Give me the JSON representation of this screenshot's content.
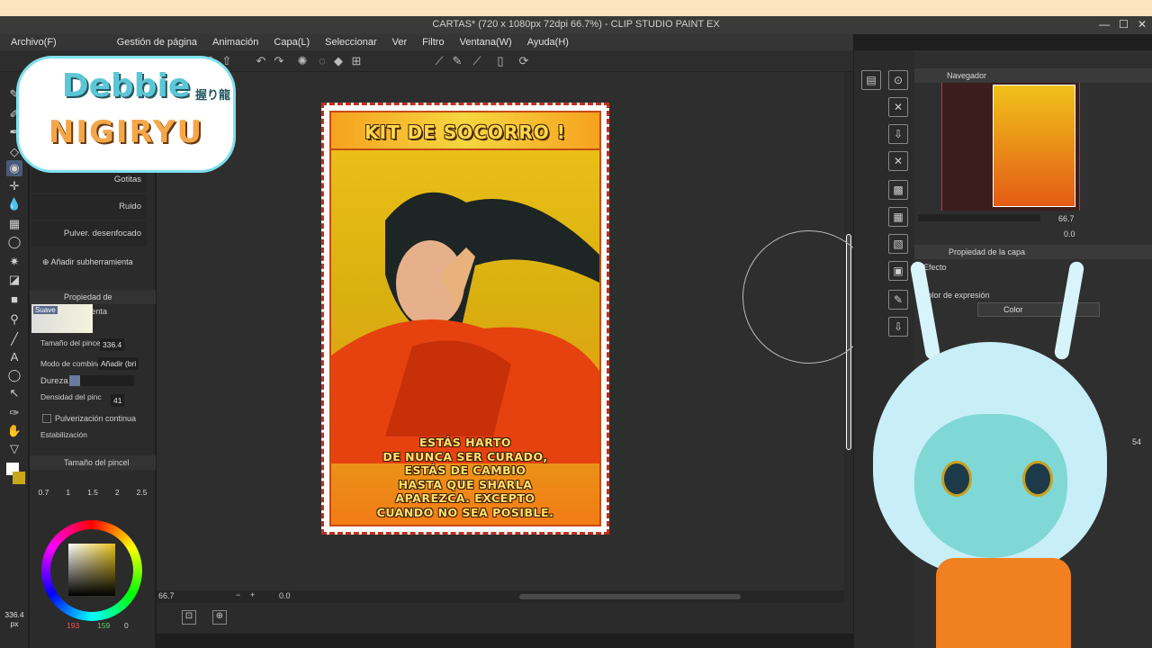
{
  "window": {
    "title": "CARTAS* (720 x 1080px 72dpi 66.7%)  - CLIP STUDIO PAINT EX"
  },
  "menu": [
    "Archivo(F)",
    "Gestión de página",
    "Animación",
    "Capa(L)",
    "Seleccionar",
    "Ver",
    "Filtro",
    "Ventana(W)",
    "Ayuda(H)"
  ],
  "subtool": {
    "brushes": [
      "Gotitas",
      "Ruido",
      "Pulver. desenfocado"
    ],
    "add_label": "Añadir subherramienta"
  },
  "tool_property": {
    "header": "Propiedad de herramienta",
    "preset": "Suave",
    "brush_size_label": "Tamaño del pincel",
    "brush_size_value": "336.4",
    "blend_label": "Modo de combinac",
    "blend_value": "Añadir (bri",
    "hardness_label": "Dureza",
    "density_label": "Densidad del pinc",
    "density_value": "41",
    "continuous_label": "Pulverización continua",
    "stabilization_label": "Estabilización"
  },
  "brush_size_panel": {
    "header": "Tamaño del pincel",
    "sizes": [
      "0.7",
      "1",
      "1.5",
      "2",
      "2.5"
    ]
  },
  "color": {
    "r": "193",
    "g": "159",
    "b": "0",
    "accent": "#e6c21a"
  },
  "cursor_size": {
    "value": "336.4",
    "unit": "px"
  },
  "canvas_status": {
    "zoom": "66.7",
    "rotation": "0.0"
  },
  "card": {
    "title": "KIT DE SOCORRO !",
    "body_lines": [
      "ESTÁS HARTO",
      "DE NUNCA SER CURADO,",
      "ESTÁS DE CAMBIO",
      "HASTA QUE SHARLA",
      "APAREZCA. EXCEPTO",
      "CUANDO NO SEA POSIBLE."
    ]
  },
  "navigator": {
    "tab": "Navegador",
    "zoom": "66.7",
    "rotation": "0.0"
  },
  "layer_property": {
    "tab": "Propiedad de la capa",
    "effect_label": "Efecto",
    "expression_label": "Color de expresión",
    "expression_value": "Color",
    "opacity": "54"
  },
  "logo": {
    "line1": "Debbie",
    "line2": "NIGIRYU",
    "kanji": "握り龍"
  }
}
